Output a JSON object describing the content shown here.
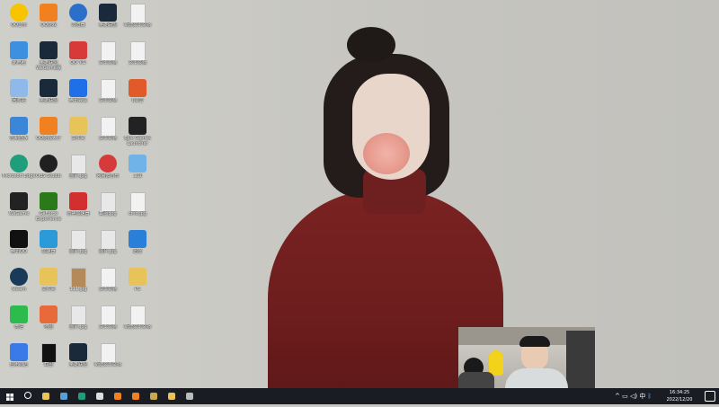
{
  "wallpaper": {
    "description_colors": {
      "background": "#c9c8c3",
      "sweater": "#6d1d1d",
      "hair": "#231c1a"
    }
  },
  "desktop_icons": [
    {
      "label": "QQ音乐",
      "icon": "music-icon",
      "color": "#f7c400"
    },
    {
      "label": "QQ游戏",
      "icon": "game-icon",
      "color": "#f08020"
    },
    {
      "label": "浏览器",
      "icon": "globe-icon",
      "color": "#2a6fc9"
    },
    {
      "label": "英雄联盟",
      "icon": "league-icon",
      "color": "#1b2a3a"
    },
    {
      "label": "新建文本文档",
      "icon": "document-icon",
      "color": "#f2f2f2"
    },
    {
      "label": "此电脑",
      "icon": "computer-icon",
      "color": "#3d8fe0"
    },
    {
      "label": "英雄联盟WeGame版",
      "icon": "league-icon",
      "color": "#1b2a3a"
    },
    {
      "label": "QQ飞车",
      "icon": "game-icon",
      "color": "#d83a3a"
    },
    {
      "label": "文本文档",
      "icon": "document-icon",
      "color": "#f2f2f2"
    },
    {
      "label": "文本文档",
      "icon": "document-icon",
      "color": "#f2f2f2"
    },
    {
      "label": "回收站",
      "icon": "recycle-bin-icon",
      "color": "#8fb9e8"
    },
    {
      "label": "英雄联盟",
      "icon": "league-icon",
      "color": "#1b2a3a"
    },
    {
      "label": "腾讯会议",
      "icon": "meeting-icon",
      "color": "#1e6fe8"
    },
    {
      "label": "文本文档",
      "icon": "document-icon",
      "color": "#f2f2f2"
    },
    {
      "label": "QQ堂",
      "icon": "game-icon",
      "color": "#e05a2a"
    },
    {
      "label": "控制面板",
      "icon": "control-panel-icon",
      "color": "#3b86d8"
    },
    {
      "label": "QQ游戏大厅",
      "icon": "game-icon",
      "color": "#f08020"
    },
    {
      "label": "文件夹",
      "icon": "folder-icon",
      "color": "#e8c35a"
    },
    {
      "label": "文本文档",
      "icon": "document-icon",
      "color": "#f2f2f2"
    },
    {
      "label": "Epic Games Launcher",
      "icon": "epic-icon",
      "color": "#222222"
    },
    {
      "label": "Microsoft Edge",
      "icon": "edge-icon",
      "color": "#1e9e7a"
    },
    {
      "label": "OBS Studio",
      "icon": "obs-icon",
      "color": "#202020"
    },
    {
      "label": "图片.jpg",
      "icon": "image-icon",
      "color": "#e8e8e8"
    },
    {
      "label": "网易云音乐",
      "icon": "music-icon",
      "color": "#d73a3a"
    },
    {
      "label": "工具",
      "icon": "tool-icon",
      "color": "#6fb3e8"
    },
    {
      "label": "WeGame",
      "icon": "wegame-icon",
      "color": "#222222"
    },
    {
      "label": "GeForce Experience",
      "icon": "nvidia-icon",
      "color": "#2a7a1a"
    },
    {
      "label": "雷神加速器",
      "icon": "app-icon",
      "color": "#d32f2f"
    },
    {
      "label": "截图.jpg",
      "icon": "image-icon",
      "color": "#e8e8e8"
    },
    {
      "label": "cmd.jpg",
      "icon": "image-icon",
      "color": "#f2f2f2"
    },
    {
      "label": "腾讯QQ",
      "icon": "qq-icon",
      "color": "#111111"
    },
    {
      "label": "加速器",
      "icon": "app-icon",
      "color": "#2a9bd8"
    },
    {
      "label": "图片.jpg",
      "icon": "image-icon",
      "color": "#e8e8e8"
    },
    {
      "label": "图片.jpg",
      "icon": "image-icon",
      "color": "#e8e8e8"
    },
    {
      "label": "迅雷",
      "icon": "download-icon",
      "color": "#2a7fd8"
    },
    {
      "label": "Steam",
      "icon": "steam-icon",
      "color": "#1a3a5a"
    },
    {
      "label": "文件夹",
      "icon": "folder-icon",
      "color": "#e8c35a"
    },
    {
      "label": "111.jpg",
      "icon": "image-icon",
      "color": "#b58a5a"
    },
    {
      "label": "文本文档",
      "icon": "document-icon",
      "color": "#f2f2f2"
    },
    {
      "label": "PS",
      "icon": "folder-icon",
      "color": "#e8c35a"
    },
    {
      "label": "微信",
      "icon": "wechat-icon",
      "color": "#2dbb4e"
    },
    {
      "label": "地图",
      "icon": "map-icon",
      "color": "#e86a3a"
    },
    {
      "label": "图片.jpg",
      "icon": "image-icon",
      "color": "#e8e8e8"
    },
    {
      "label": "文本文档",
      "icon": "document-icon",
      "color": "#f2f2f2"
    },
    {
      "label": "新建文本文档",
      "icon": "document-icon",
      "color": "#f2f2f2"
    },
    {
      "label": "应用商店",
      "icon": "app-icon",
      "color": "#3a7ae8"
    },
    {
      "label": "截图",
      "icon": "image-icon",
      "color": "#111111"
    },
    {
      "label": "英雄联盟",
      "icon": "league-icon",
      "color": "#1b2a3a"
    },
    {
      "label": "新建文本文档",
      "icon": "document-icon",
      "color": "#f2f2f2"
    }
  ],
  "taskbar": {
    "start_icon": "windows-icon",
    "items": [
      {
        "icon": "search-icon",
        "color": "#ffffff"
      },
      {
        "icon": "folder-icon",
        "color": "#e8c35a"
      },
      {
        "icon": "steam-icon",
        "color": "#5aa0d8"
      },
      {
        "icon": "edge-icon",
        "color": "#1e9e7a"
      },
      {
        "icon": "obs-icon",
        "color": "#dddddd"
      },
      {
        "icon": "game-icon",
        "color": "#f08020"
      },
      {
        "icon": "game-icon",
        "color": "#f08020"
      },
      {
        "icon": "league-icon",
        "color": "#c9a74a"
      },
      {
        "icon": "app-icon",
        "color": "#e8c35a"
      },
      {
        "icon": "obs-icon",
        "color": "#bbbbbb"
      }
    ],
    "clock_time": "16:34:25",
    "clock_date": "2022/12/20"
  }
}
